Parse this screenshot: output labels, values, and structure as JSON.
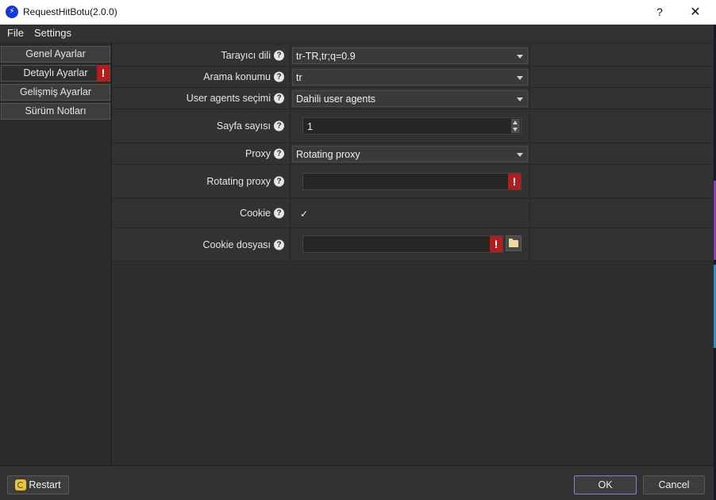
{
  "window": {
    "title": "RequestHitBotu(2.0.0)",
    "help_label": "?",
    "close_label": "✕",
    "app_icon": "lightning-icon"
  },
  "menu": {
    "items": [
      "File",
      "Settings"
    ]
  },
  "sidebar": {
    "items": [
      {
        "label": "Genel Ayarlar",
        "warning": false
      },
      {
        "label": "Detaylı Ayarlar",
        "warning": true
      },
      {
        "label": "Gelişmiş Ayarlar",
        "warning": false
      },
      {
        "label": "Sürüm Notları",
        "warning": false
      }
    ],
    "warning_glyph": "!"
  },
  "settings": {
    "browser_language": {
      "label": "Tarayıcı dili",
      "value": "tr-TR,tr;q=0.9"
    },
    "search_location": {
      "label": "Arama konumu",
      "value": "tr"
    },
    "user_agents": {
      "label": "User agents seçimi",
      "value": "Dahili user agents"
    },
    "page_count": {
      "label": "Sayfa sayısı",
      "value": "1"
    },
    "proxy": {
      "label": "Proxy",
      "value": "Rotating proxy"
    },
    "rotating_proxy": {
      "label": "Rotating proxy",
      "value": ""
    },
    "cookie": {
      "label": "Cookie",
      "checked": true,
      "check_glyph": "✓"
    },
    "cookie_file": {
      "label": "Cookie dosyası",
      "value": ""
    },
    "help_glyph": "?"
  },
  "footer": {
    "restart_label": "Restart",
    "ok_label": "OK",
    "cancel_label": "Cancel"
  },
  "colors": {
    "warning": "#b01e1e",
    "primary_border": "#9b78c8",
    "background": "#2b2b2b"
  }
}
